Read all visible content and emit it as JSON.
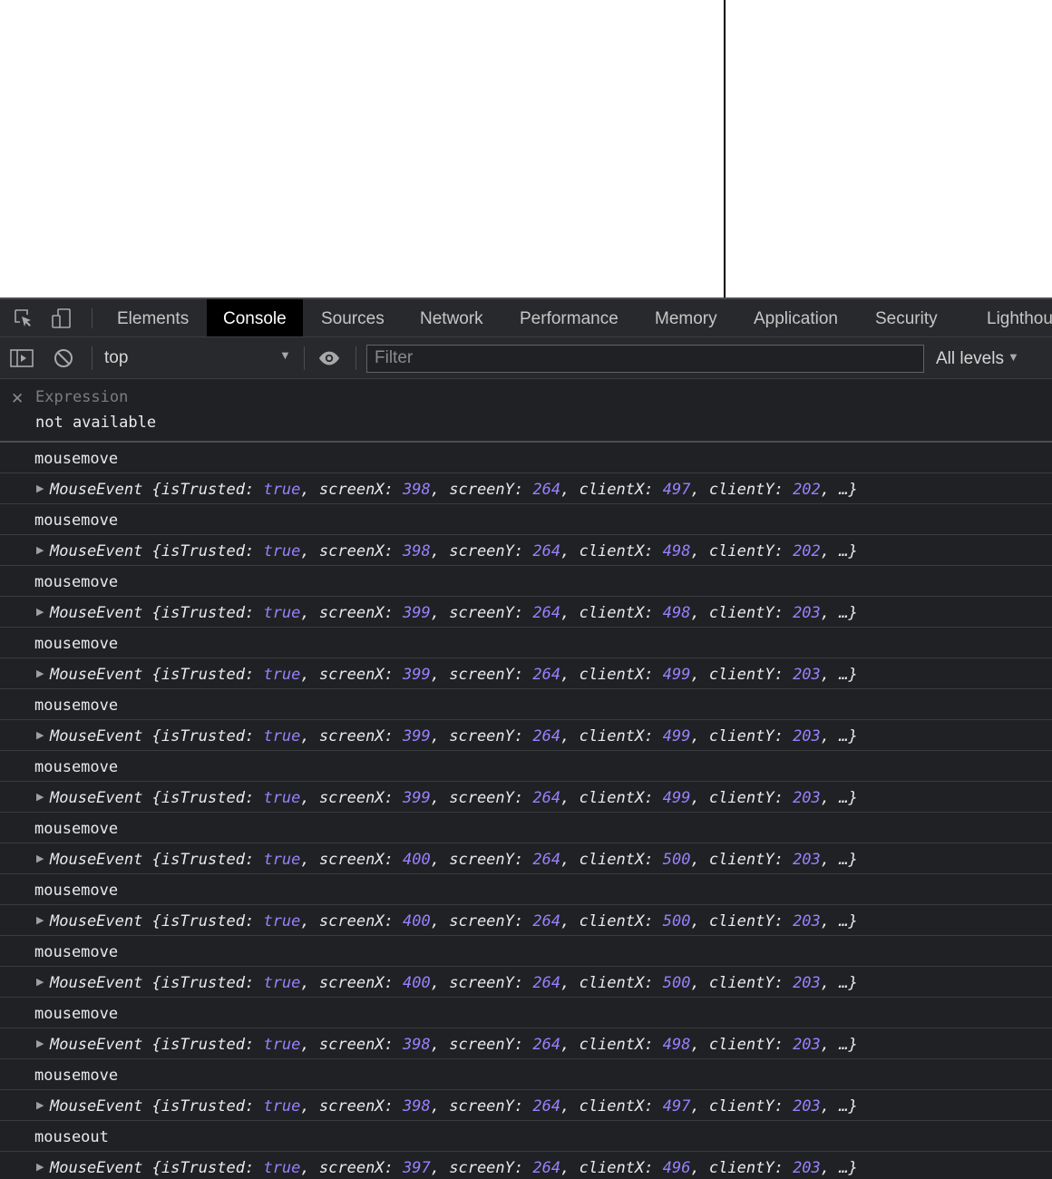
{
  "devtools": {
    "tabs": [
      "Elements",
      "Console",
      "Sources",
      "Network",
      "Performance",
      "Memory",
      "Application",
      "Security",
      "Lighthou"
    ],
    "active_tab": "Console",
    "toolbar": {
      "context": "top",
      "filter_placeholder": "Filter",
      "levels": "All levels"
    },
    "expression": {
      "label": "Expression",
      "value": "not available"
    }
  },
  "object_labels": {
    "type": "MouseEvent",
    "isTrusted_key": "isTrusted:",
    "screenX_key": "screenX:",
    "screenY_key": "screenY:",
    "clientX_key": "clientX:",
    "clientY_key": "clientY:",
    "ellipsis": "…"
  },
  "log": [
    {
      "event": "mousemove",
      "isTrusted": "true",
      "screenX": "398",
      "screenY": "264",
      "clientX": "497",
      "clientY": "202"
    },
    {
      "event": "mousemove",
      "isTrusted": "true",
      "screenX": "398",
      "screenY": "264",
      "clientX": "498",
      "clientY": "202"
    },
    {
      "event": "mousemove",
      "isTrusted": "true",
      "screenX": "399",
      "screenY": "264",
      "clientX": "498",
      "clientY": "203"
    },
    {
      "event": "mousemove",
      "isTrusted": "true",
      "screenX": "399",
      "screenY": "264",
      "clientX": "499",
      "clientY": "203"
    },
    {
      "event": "mousemove",
      "isTrusted": "true",
      "screenX": "399",
      "screenY": "264",
      "clientX": "499",
      "clientY": "203"
    },
    {
      "event": "mousemove",
      "isTrusted": "true",
      "screenX": "399",
      "screenY": "264",
      "clientX": "499",
      "clientY": "203"
    },
    {
      "event": "mousemove",
      "isTrusted": "true",
      "screenX": "400",
      "screenY": "264",
      "clientX": "500",
      "clientY": "203"
    },
    {
      "event": "mousemove",
      "isTrusted": "true",
      "screenX": "400",
      "screenY": "264",
      "clientX": "500",
      "clientY": "203"
    },
    {
      "event": "mousemove",
      "isTrusted": "true",
      "screenX": "400",
      "screenY": "264",
      "clientX": "500",
      "clientY": "203"
    },
    {
      "event": "mousemove",
      "isTrusted": "true",
      "screenX": "398",
      "screenY": "264",
      "clientX": "498",
      "clientY": "203"
    },
    {
      "event": "mousemove",
      "isTrusted": "true",
      "screenX": "398",
      "screenY": "264",
      "clientX": "497",
      "clientY": "203"
    },
    {
      "event": "mouseout",
      "isTrusted": "true",
      "screenX": "397",
      "screenY": "264",
      "clientX": "496",
      "clientY": "203"
    }
  ]
}
